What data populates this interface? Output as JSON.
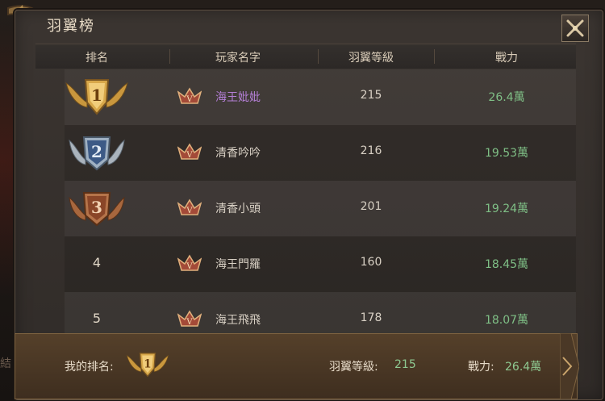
{
  "window": {
    "title": "羽翼榜"
  },
  "header": {
    "rank": "排名",
    "player_name": "玩家名字",
    "wing_level": "羽翼等級",
    "power": "戰力"
  },
  "rows": [
    {
      "rank": "1",
      "name": "海王妣妣",
      "level": "215",
      "power": "26.4萬"
    },
    {
      "rank": "2",
      "name": "清香吟吟",
      "level": "216",
      "power": "19.53萬"
    },
    {
      "rank": "3",
      "name": "清香小頭",
      "level": "201",
      "power": "19.24萬"
    },
    {
      "rank": "4",
      "name": "海王門羅",
      "level": "160",
      "power": "18.45萬"
    },
    {
      "rank": "5",
      "name": "海王飛飛",
      "level": "178",
      "power": "18.07萬"
    }
  ],
  "my": {
    "rank_label": "我的排名:",
    "rank": "1",
    "level_label": "羽翼等級:",
    "level": "215",
    "power_label": "戰力:",
    "power": "26.4萬"
  },
  "colors": {
    "gold": "#c9973d",
    "silver": "#aab3bc",
    "bronze": "#a7673e",
    "name_highlight": "#b47fd6",
    "power_green": "#7fbf86"
  },
  "icons": {
    "close": "close-icon",
    "vip": "vip-badge-icon",
    "rank_badge": "rank-wing-badge-icon"
  },
  "background_text": {
    "side_glyph": "結"
  }
}
